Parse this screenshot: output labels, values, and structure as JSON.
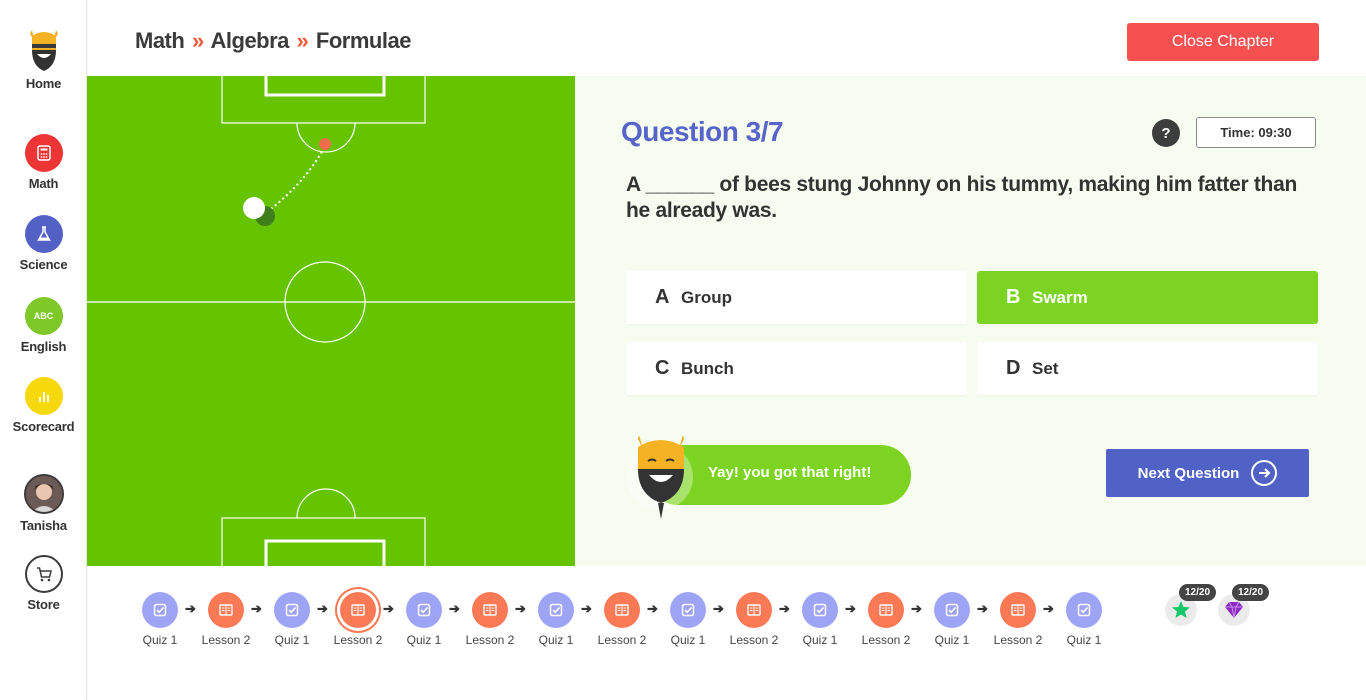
{
  "sidebar": {
    "home_label": "Home",
    "items": [
      {
        "label": "Math",
        "color": "#ee3535"
      },
      {
        "label": "Science",
        "color": "#5361c6"
      },
      {
        "label": "English",
        "color": "#7ec828",
        "icon_text": "ABC"
      },
      {
        "label": "Scorecard",
        "color": "#f5d90a"
      }
    ],
    "user_label": "Tanisha",
    "store_label": "Store"
  },
  "header": {
    "breadcrumb": [
      "Math",
      "Algebra",
      "Formulae"
    ],
    "separator": "»",
    "close_label": "Close Chapter"
  },
  "question": {
    "title": "Question 3/7",
    "help": "?",
    "timer": "Time: 09:30",
    "text": "A ______ of bees stung Johnny on his tummy, making him fatter than he already was.",
    "options": [
      {
        "letter": "A",
        "label": "Group",
        "selected": false
      },
      {
        "letter": "B",
        "label": "Swarm",
        "selected": true
      },
      {
        "letter": "C",
        "label": "Bunch",
        "selected": false
      },
      {
        "letter": "D",
        "label": "Set",
        "selected": false
      }
    ],
    "feedback": "Yay! you got that right!",
    "next_label": "Next Question"
  },
  "progress": {
    "steps": [
      {
        "label": "Quiz 1",
        "type": "quiz"
      },
      {
        "label": "Lesson 2",
        "type": "lesson"
      },
      {
        "label": "Quiz 1",
        "type": "quiz"
      },
      {
        "label": "Lesson 2",
        "type": "lesson",
        "current": true
      },
      {
        "label": "Quiz 1",
        "type": "quiz"
      },
      {
        "label": "Lesson 2",
        "type": "lesson"
      },
      {
        "label": "Quiz 1",
        "type": "quiz"
      },
      {
        "label": "Lesson 2",
        "type": "lesson"
      },
      {
        "label": "Quiz 1",
        "type": "quiz"
      },
      {
        "label": "Lesson 2",
        "type": "lesson"
      },
      {
        "label": "Quiz 1",
        "type": "quiz"
      },
      {
        "label": "Lesson 2",
        "type": "lesson"
      },
      {
        "label": "Quiz 1",
        "type": "quiz"
      },
      {
        "label": "Lesson 2",
        "type": "lesson"
      },
      {
        "label": "Quiz 1",
        "type": "quiz"
      }
    ],
    "arrow": "➔",
    "stars": "12/20",
    "gems": "12/20"
  },
  "colors": {
    "accent": "#5162c7",
    "correct": "#7dd321",
    "close": "#f75050",
    "field": "#66c300"
  }
}
